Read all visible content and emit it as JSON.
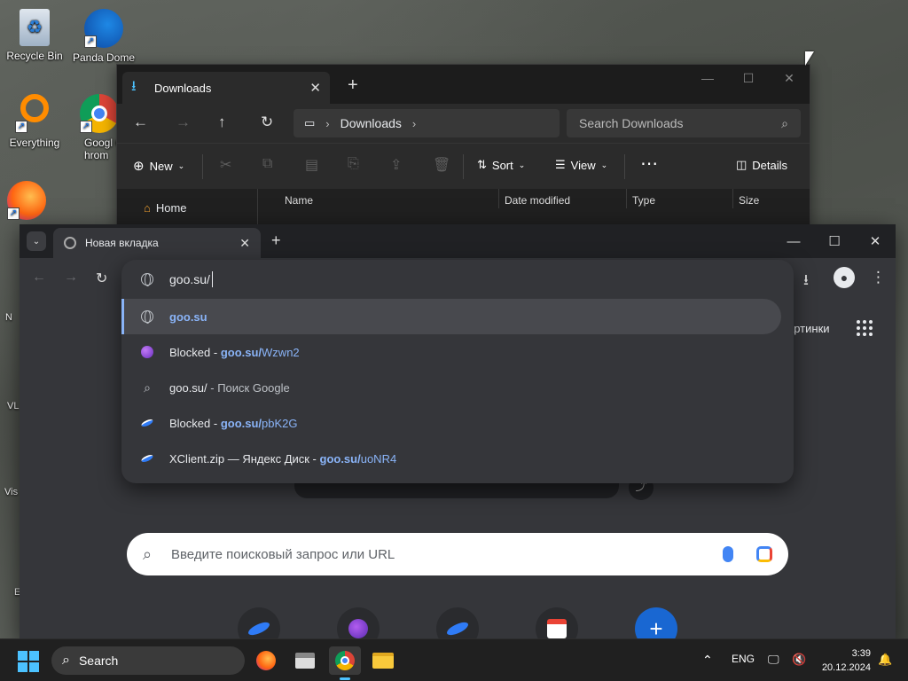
{
  "desktop": {
    "icons": [
      {
        "label": "Recycle Bin"
      },
      {
        "label": "Panda Dome"
      },
      {
        "label": "Everything"
      },
      {
        "label": "Googl Chrom"
      }
    ],
    "edge_labels": [
      "N",
      "VL",
      "Vis",
      "E"
    ]
  },
  "explorer": {
    "tab_title": "Downloads",
    "breadcrumb": "Downloads",
    "search_placeholder": "Search Downloads",
    "commands": {
      "new": "New",
      "sort": "Sort",
      "view": "View",
      "details": "Details"
    },
    "nav_home": "Home",
    "columns": [
      "Name",
      "Date modified",
      "Type",
      "Size"
    ]
  },
  "chrome": {
    "tab_title": "Новая вкладка",
    "omnibox": {
      "input_value": "goo.su/",
      "suggestions": [
        {
          "prefix": "",
          "highlight": "goo.su",
          "rest": "",
          "icon": "globe-icon"
        },
        {
          "prefix": "Blocked - ",
          "highlight": "goo.su/",
          "rest": "Wzwn2",
          "icon": "purple-site-icon"
        },
        {
          "prefix": "goo.su/",
          "highlight": "",
          "rest": " - Поиск Google",
          "icon": "search-icon"
        },
        {
          "prefix": "Blocked - ",
          "highlight": "goo.su/",
          "rest": "pbK2G",
          "icon": "yandex-disk-icon"
        },
        {
          "prefix": "XClient.zip — Яндекс Диск - ",
          "highlight": "goo.su/",
          "rest": "uoNR4",
          "icon": "yandex-disk-icon"
        }
      ]
    },
    "ntp": {
      "images_link": "артинки",
      "search_placeholder": "Введите поисковый запрос или URL"
    }
  },
  "taskbar": {
    "search_label": "Search",
    "language": "ENG",
    "time": "3:39",
    "date": "20.12.2024"
  },
  "colors": {
    "accent_blue": "#8ab4f8",
    "windows_accent": "#4cc2ff",
    "chrome_bg": "#35363a"
  }
}
